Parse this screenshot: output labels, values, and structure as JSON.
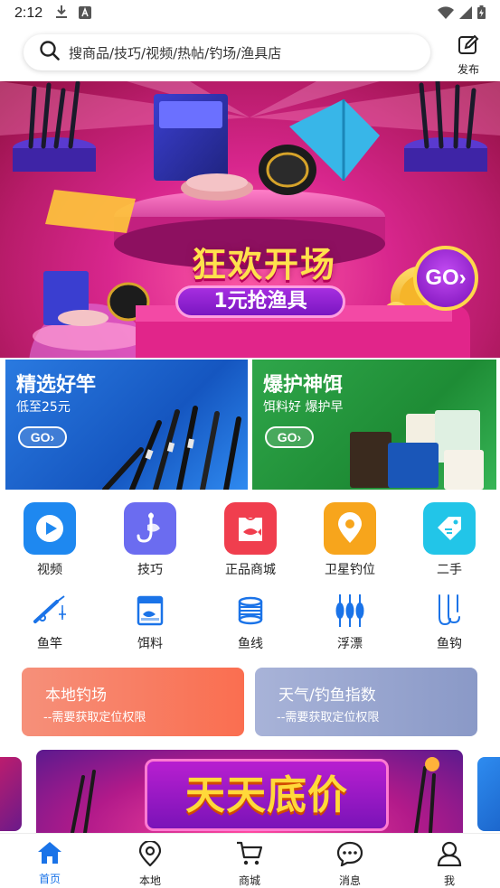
{
  "status_bar": {
    "time": "2:12"
  },
  "header": {
    "search_placeholder": "搜商品/技巧/视频/热帖/钓场/渔具店",
    "publish_label": "发布"
  },
  "main_banner": {
    "title": "狂欢开场",
    "subtitle": "1元抢渔具",
    "go_label": "GO›"
  },
  "promos": [
    {
      "title": "精选好竿",
      "subtitle": "低至25元",
      "go_label": "GO›"
    },
    {
      "title": "爆护神饵",
      "subtitle": "饵料好 爆护早",
      "go_label": "GO›"
    }
  ],
  "feature_grid": [
    {
      "label": "视频",
      "icon": "play-icon",
      "color": "#1e88f0"
    },
    {
      "label": "技巧",
      "icon": "fishing-hook-icon",
      "color": "#6b6cf0"
    },
    {
      "label": "正品商城",
      "icon": "shopping-bag-icon",
      "color": "#f03e4e"
    },
    {
      "label": "卫星钓位",
      "icon": "location-pin-icon",
      "color": "#f7a51c"
    },
    {
      "label": "二手",
      "icon": "price-tag-icon",
      "color": "#22c5e8"
    }
  ],
  "category_grid": [
    {
      "label": "鱼竿",
      "icon": "fishing-rod-icon"
    },
    {
      "label": "饵料",
      "icon": "bait-box-icon"
    },
    {
      "label": "鱼线",
      "icon": "fishing-line-icon"
    },
    {
      "label": "浮漂",
      "icon": "float-icon"
    },
    {
      "label": "鱼钩",
      "icon": "fish-hook-icon"
    }
  ],
  "location_cards": [
    {
      "title": "本地钓场",
      "subtitle": "--需要获取定位权限"
    },
    {
      "title": "天气/钓鱼指数",
      "subtitle": "--需要获取定位权限"
    }
  ],
  "carousel": {
    "title": "天天底价"
  },
  "tab_bar": [
    {
      "label": "首页",
      "icon": "home-icon",
      "active": true
    },
    {
      "label": "本地",
      "icon": "map-pin-icon",
      "active": false
    },
    {
      "label": "商城",
      "icon": "cart-icon",
      "active": false
    },
    {
      "label": "消息",
      "icon": "chat-icon",
      "active": false
    },
    {
      "label": "我",
      "icon": "user-icon",
      "active": false
    }
  ],
  "colors": {
    "accent": "#1a73e8",
    "rod_card": "#1f6ad8",
    "bait_card": "#27a043"
  }
}
